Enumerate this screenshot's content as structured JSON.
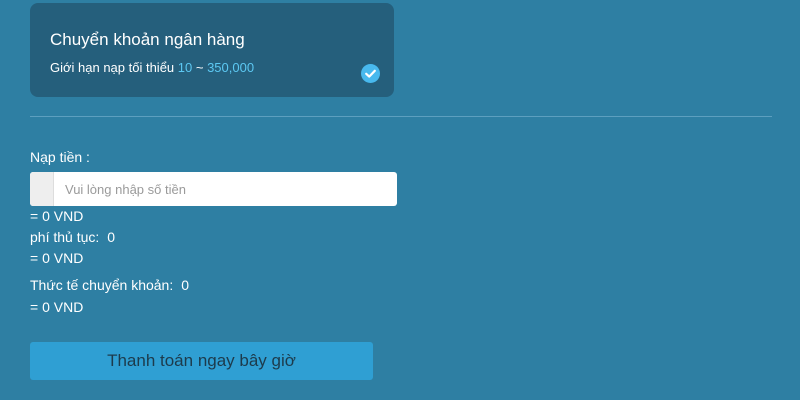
{
  "method": {
    "title": "Chuyển khoản ngân hàng",
    "limit_prefix": "Giới hạn nạp tối thiểu ",
    "limit_min": "10",
    "limit_sep": " ~ ",
    "limit_max": "350,000",
    "selected_icon": "check-circle-icon"
  },
  "deposit": {
    "label": "Nạp tiền :",
    "placeholder": "Vui lòng nhập số tiền",
    "value": "",
    "converted": "= 0 VND"
  },
  "fee": {
    "label": "phí thủ tục:",
    "value": "0",
    "converted": "= 0 VND"
  },
  "actual": {
    "label": "Thức tế chuyển khoản:",
    "value": "0",
    "converted": "= 0 VND"
  },
  "actions": {
    "pay_label": "Thanh toán ngay bây giờ"
  },
  "colors": {
    "background": "#2e7fa3",
    "card": "#255f7c",
    "highlight": "#5cc8f2",
    "button": "#2f9fd3",
    "check": "#48b9ee"
  }
}
